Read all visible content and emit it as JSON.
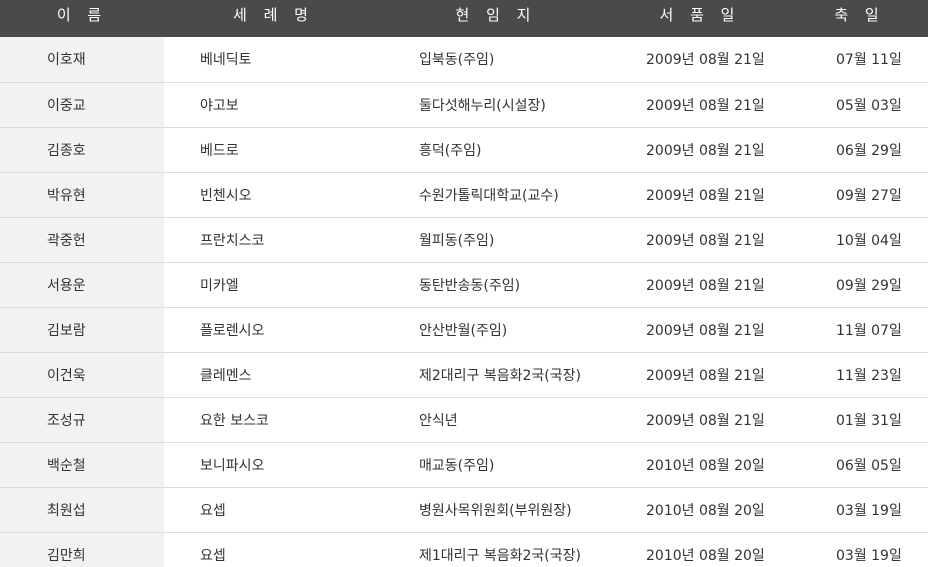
{
  "table": {
    "headers": [
      "이 름",
      "세 례 명",
      "현 임 지",
      "서 품 일",
      "축 일"
    ],
    "rows": [
      {
        "name": "이호재",
        "baptism": "베네딕토",
        "post": "입북동(주임)",
        "ordination": "2009년 08월 21일",
        "feast": "07월 11일"
      },
      {
        "name": "이중교",
        "baptism": "야고보",
        "post": "둘다섯해누리(시설장)",
        "ordination": "2009년 08월 21일",
        "feast": "05월 03일"
      },
      {
        "name": "김종호",
        "baptism": "베드로",
        "post": "흥덕(주임)",
        "ordination": "2009년 08월 21일",
        "feast": "06월 29일"
      },
      {
        "name": "박유현",
        "baptism": "빈첸시오",
        "post": "수원가톨릭대학교(교수)",
        "ordination": "2009년 08월 21일",
        "feast": "09월 27일"
      },
      {
        "name": "곽중헌",
        "baptism": "프란치스코",
        "post": "월피동(주임)",
        "ordination": "2009년 08월 21일",
        "feast": "10월 04일"
      },
      {
        "name": "서용운",
        "baptism": "미카엘",
        "post": "동탄반송동(주임)",
        "ordination": "2009년 08월 21일",
        "feast": "09월 29일"
      },
      {
        "name": "김보람",
        "baptism": "플로렌시오",
        "post": "안산반월(주임)",
        "ordination": "2009년 08월 21일",
        "feast": "11월 07일"
      },
      {
        "name": "이건욱",
        "baptism": "클레멘스",
        "post": "제2대리구 복음화2국(국장)",
        "ordination": "2009년 08월 21일",
        "feast": "11월 23일"
      },
      {
        "name": "조성규",
        "baptism": "요한 보스코",
        "post": "안식년",
        "ordination": "2009년 08월 21일",
        "feast": "01월 31일"
      },
      {
        "name": "백순철",
        "baptism": "보니파시오",
        "post": "매교동(주임)",
        "ordination": "2010년 08월 20일",
        "feast": "06월 05일"
      },
      {
        "name": "최원섭",
        "baptism": "요셉",
        "post": "병원사목위원회(부위원장)",
        "ordination": "2010년 08월 20일",
        "feast": "03월 19일"
      },
      {
        "name": "김만희",
        "baptism": "요셉",
        "post": "제1대리구 복음화2국(국장)",
        "ordination": "2010년 08월 20일",
        "feast": "03월 19일"
      }
    ]
  }
}
